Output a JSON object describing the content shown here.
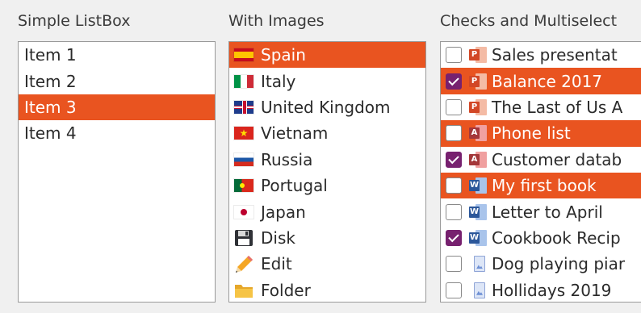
{
  "groups": {
    "simple": {
      "title": "Simple ListBox",
      "items": [
        {
          "label": "Item 1",
          "selected": false
        },
        {
          "label": "Item 2",
          "selected": false
        },
        {
          "label": "Item 3",
          "selected": true
        },
        {
          "label": "Item 4",
          "selected": false
        }
      ]
    },
    "images": {
      "title": "With Images",
      "items": [
        {
          "label": "Spain",
          "icon": "spain-flag-icon",
          "selected": true
        },
        {
          "label": "Italy",
          "icon": "italy-flag-icon",
          "selected": false
        },
        {
          "label": "United Kingdom",
          "icon": "uk-flag-icon",
          "selected": false
        },
        {
          "label": "Vietnam",
          "icon": "vietnam-flag-icon",
          "selected": false
        },
        {
          "label": "Russia",
          "icon": "russia-flag-icon",
          "selected": false
        },
        {
          "label": "Portugal",
          "icon": "portugal-flag-icon",
          "selected": false
        },
        {
          "label": "Japan",
          "icon": "japan-flag-icon",
          "selected": false
        },
        {
          "label": "Disk",
          "icon": "floppy-disk-icon",
          "selected": false
        },
        {
          "label": "Edit",
          "icon": "pencil-icon",
          "selected": false
        },
        {
          "label": "Folder",
          "icon": "folder-icon",
          "selected": false
        }
      ]
    },
    "checks": {
      "title": "Checks and Multiselect",
      "items": [
        {
          "label": "Sales presentat",
          "icon": "powerpoint-icon",
          "checked": false,
          "selected": false
        },
        {
          "label": "Balance 2017",
          "icon": "powerpoint-icon",
          "checked": true,
          "selected": true
        },
        {
          "label": "The Last of Us A",
          "icon": "powerpoint-icon",
          "checked": false,
          "selected": false
        },
        {
          "label": "Phone list",
          "icon": "access-icon",
          "checked": false,
          "selected": true
        },
        {
          "label": "Customer datab",
          "icon": "access-icon",
          "checked": true,
          "selected": false
        },
        {
          "label": "My first book",
          "icon": "word-icon",
          "checked": false,
          "selected": true
        },
        {
          "label": "Letter to April",
          "icon": "word-icon",
          "checked": false,
          "selected": false
        },
        {
          "label": "Cookbook Recip",
          "icon": "word-icon",
          "checked": true,
          "selected": false
        },
        {
          "label": "Dog playing piar",
          "icon": "image-file-icon",
          "checked": false,
          "selected": false
        },
        {
          "label": "Hollidays 2019",
          "icon": "image-file-icon",
          "checked": false,
          "selected": false
        }
      ]
    }
  },
  "colors": {
    "selection": "#e95420",
    "check": "#77216f"
  }
}
